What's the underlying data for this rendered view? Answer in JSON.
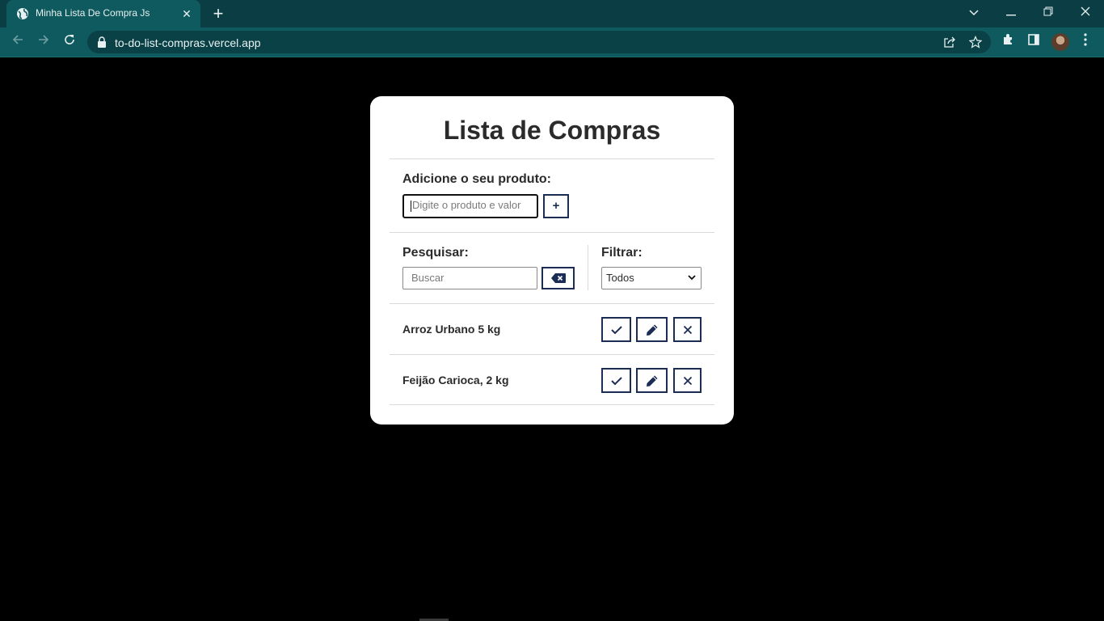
{
  "browser": {
    "tab_title": "Minha Lista De Compra Js",
    "url": "to-do-list-compras.vercel.app"
  },
  "app": {
    "title": "Lista de Compras",
    "add_label": "Adicione o seu produto:",
    "add_placeholder": "Digite o produto e valor",
    "add_button": "+",
    "search_label": "Pesquisar:",
    "search_placeholder": "Buscar",
    "filter_label": "Filtrar:",
    "filter_selected": "Todos",
    "items": [
      {
        "text": "Arroz Urbano 5 kg"
      },
      {
        "text": "Feijão Carioca, 2 kg"
      }
    ]
  },
  "colors": {
    "accent": "#1c2d55",
    "browser_frame": "#0f5a5e"
  }
}
